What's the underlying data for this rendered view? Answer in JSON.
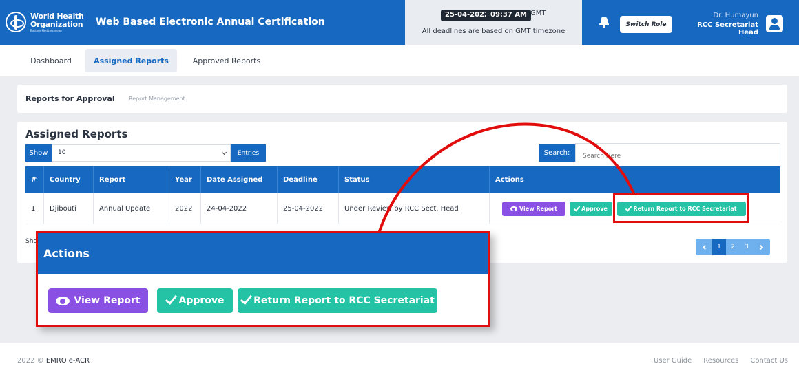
{
  "header": {
    "org_line1": "World Health",
    "org_line2": "Organization",
    "org_line3": "Eastern Mediterranean",
    "app_title": "Web Based Electronic Annual Certification",
    "date": "25-04-2022",
    "time": "09:37 AM",
    "timezone": "GMT",
    "timezone_note": "All deadlines are based on GMT timezone",
    "switch_role": "Switch Role",
    "user_name": "Dr. Humayun",
    "user_role": "RCC Secretariat Head"
  },
  "tabs": [
    {
      "label": "Dashboard"
    },
    {
      "label": "Assigned Reports",
      "active": true
    },
    {
      "label": "Approved Reports"
    }
  ],
  "breadcrumb": {
    "title": "Reports for Approval",
    "sub": "Report Management"
  },
  "reports": {
    "title": "Assigned Reports",
    "show_label": "Show",
    "show_value": "10",
    "entries_label": "Entries",
    "search_label": "Search:",
    "search_placeholder": "Search Here",
    "columns": [
      "#",
      "Country",
      "Report",
      "Year",
      "Date Assigned",
      "Deadline",
      "Status",
      "Actions"
    ],
    "rows": [
      {
        "num": "1",
        "country": "Djibouti",
        "report": "Annual Update",
        "year": "2022",
        "date_assigned": "24-04-2022",
        "deadline": "25-04-2022",
        "status": "Under Review by RCC Sect. Head"
      }
    ],
    "actions": {
      "view": "View Report",
      "approve": "Approve",
      "return": "Return Report to RCC Secretariat"
    },
    "footer_partial": "Sho",
    "pagination": [
      "1",
      "2",
      "3"
    ]
  },
  "callout": {
    "title": "Actions",
    "view": "View Report",
    "approve": "Approve",
    "return": "Return Report to RCC Secretariat"
  },
  "footer": {
    "year": "2022 ©",
    "brand": "EMRO e-ACR",
    "links": [
      "User Guide",
      "Resources",
      "Contact Us"
    ]
  },
  "colors": {
    "primary": "#1668c1",
    "view": "#8a4fe3",
    "approve": "#24c3a6",
    "highlight": "#e10d0d"
  }
}
